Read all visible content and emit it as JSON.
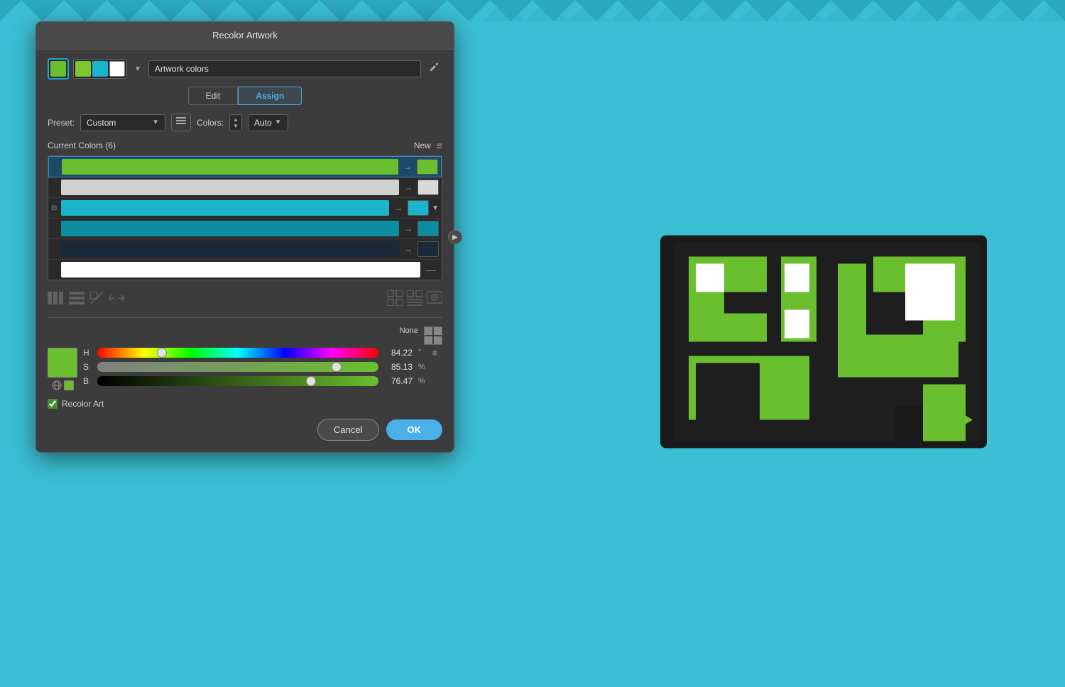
{
  "background": {
    "color": "#3bbfd4"
  },
  "dialog": {
    "title": "Recolor Artwork",
    "tabs": {
      "edit": "Edit",
      "assign": "Assign",
      "active": "assign"
    },
    "artwork_colors_label": "Artwork colors",
    "preset": {
      "label": "Preset:",
      "value": "Custom"
    },
    "colors": {
      "label": "Colors:",
      "value": "Auto"
    },
    "current_colors": {
      "title": "Current Colors (6)",
      "new_label": "New"
    },
    "color_rows": [
      {
        "id": 1,
        "bar_color": "#6abf2e",
        "new_color": "#6abf2e",
        "selected": true
      },
      {
        "id": 2,
        "bar_color": "#d0d0d0",
        "new_color": "#d8d8d8",
        "selected": false
      },
      {
        "id": 3,
        "bar_color": "#1ab4cc",
        "new_color": "#1ab4cc",
        "selected": false,
        "has_dropdown": true
      },
      {
        "id": 4,
        "bar_color": "#0d8ea0",
        "new_color": "#0d8ea0",
        "selected": false
      },
      {
        "id": 5,
        "bar_color": "#1a2a3a",
        "new_color": "#1a2a3a",
        "selected": false
      },
      {
        "id": 6,
        "bar_color": "#ffffff",
        "new_color": null,
        "selected": false
      }
    ],
    "hsb": {
      "h": {
        "label": "H",
        "value": "84.22",
        "unit": "°"
      },
      "s": {
        "label": "S",
        "value": "85.13",
        "unit": "%"
      },
      "b": {
        "label": "B",
        "value": "76.47",
        "unit": "%"
      }
    },
    "none_label": "None",
    "recolor_art_label": "Recolor Art",
    "cancel_label": "Cancel",
    "ok_label": "OK"
  }
}
